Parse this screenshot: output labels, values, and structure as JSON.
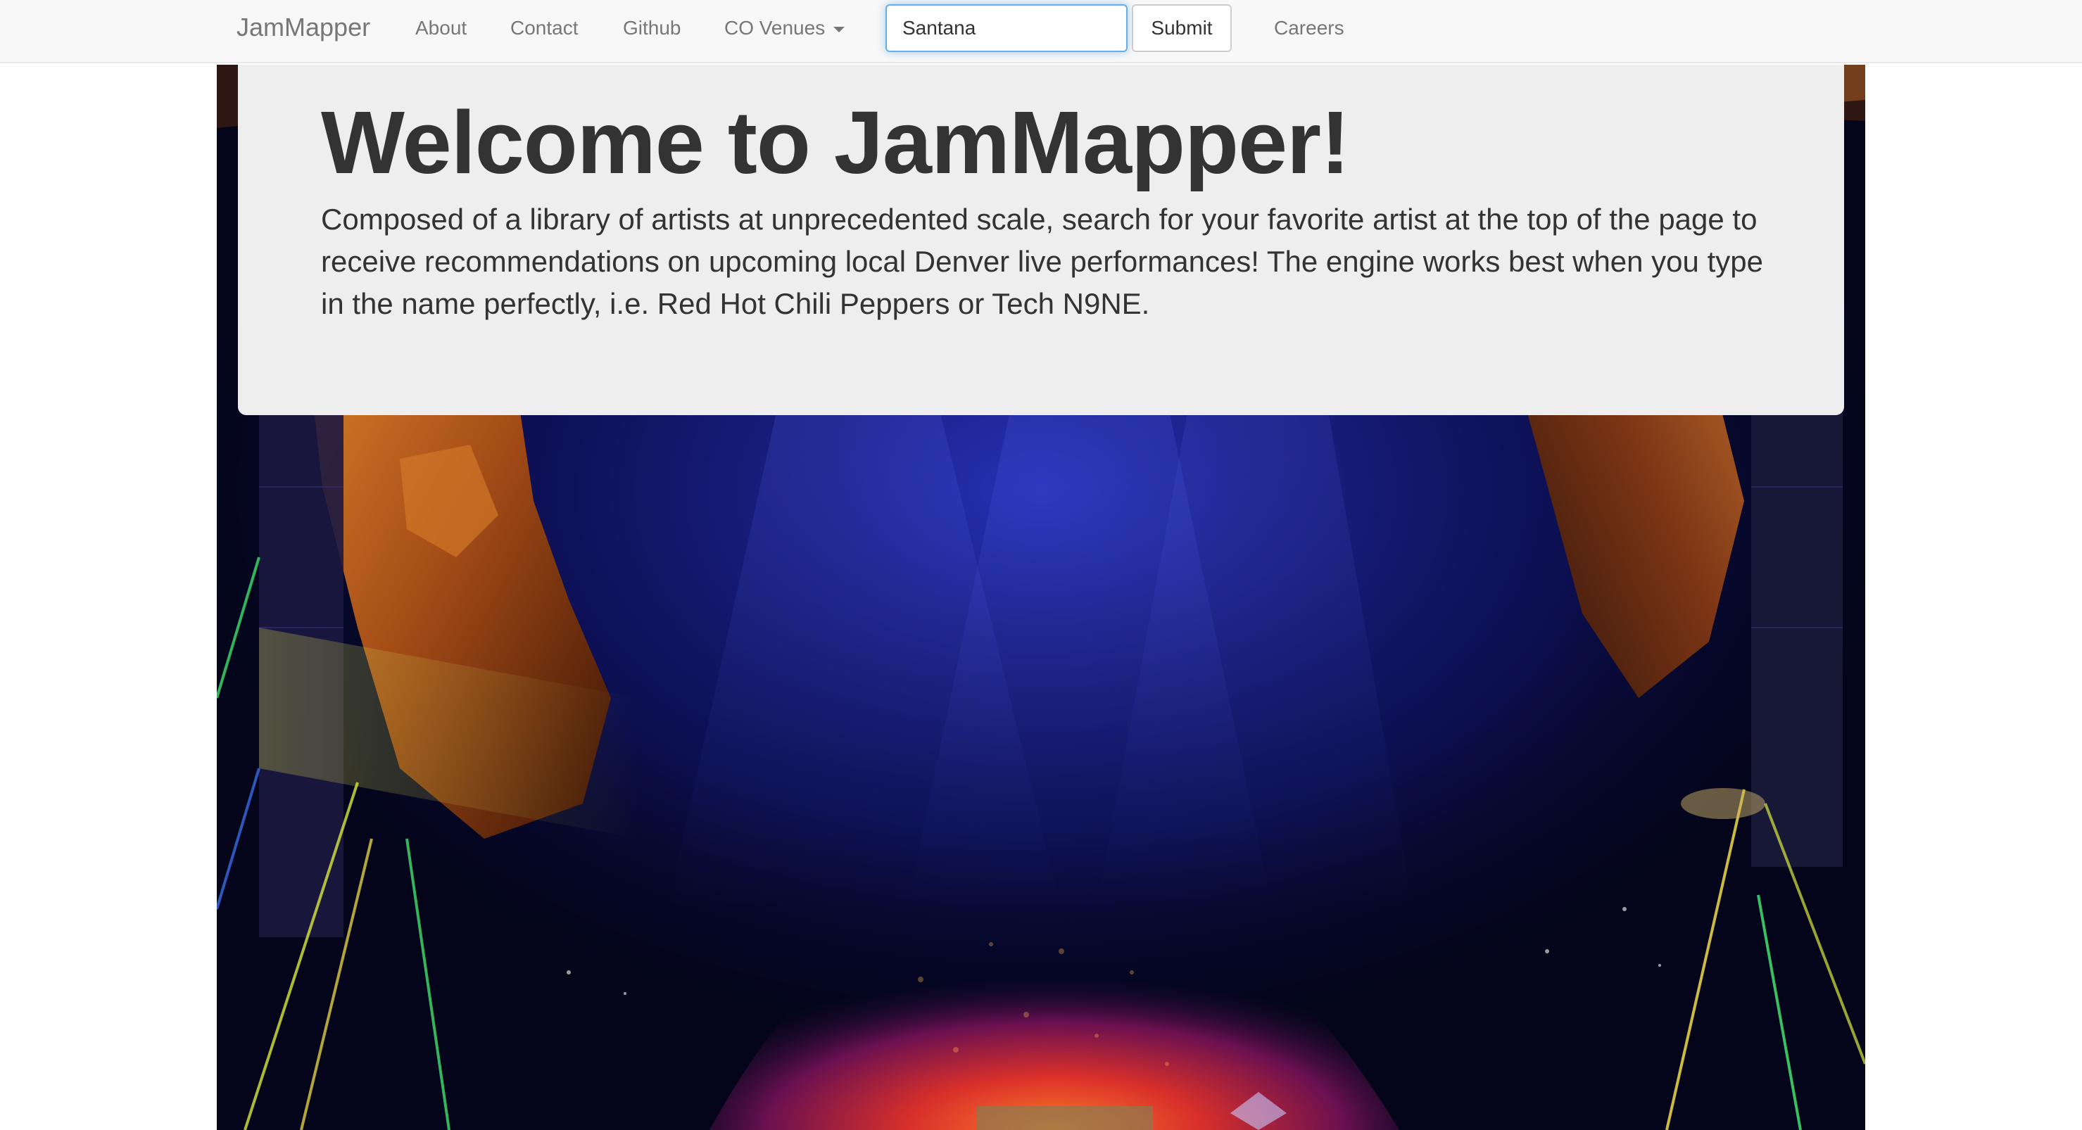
{
  "navbar": {
    "brand": "JamMapper",
    "links": {
      "about": "About",
      "contact": "Contact",
      "github": "Github",
      "venues": "CO Venues",
      "careers": "Careers"
    },
    "search": {
      "value": "Santana"
    },
    "submit_label": "Submit"
  },
  "jumbotron": {
    "title": "Welcome to JamMapper!",
    "text": "Composed of a library of artists at unprecedented scale, search for your favorite artist at the top of the page to receive recommendations on upcoming local Denver live performances! The engine works best when you type in the name perfectly, i.e. Red Hot Chili Peppers or Tech N9NE."
  },
  "colors": {
    "navbar_bg": "#f8f8f8",
    "nav_text": "#777777",
    "jumbotron_bg": "#eeeeee",
    "heading_text": "#333333",
    "input_focus_border": "#66afe9",
    "stage_light_blue": "#3b4cff",
    "stage_light_magenta": "#ff4fd8",
    "rock_orange": "#c96a1f",
    "crowd_red": "#d9302a"
  }
}
